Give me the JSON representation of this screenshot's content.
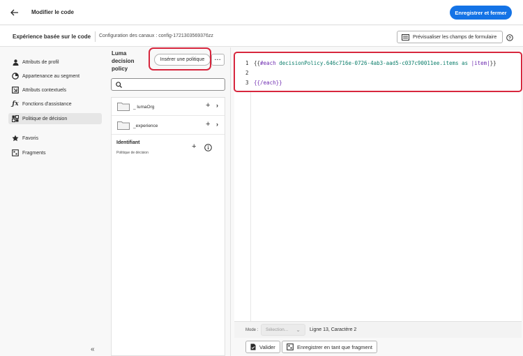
{
  "topbar": {
    "title": "Modifier le code",
    "save_close": "Enregistrer et fermer"
  },
  "subbar": {
    "title": "Expérience basée sur le code",
    "config": "Configuration des canaux : config-1721303569376zz",
    "preview_label": "Prévisualiser les champs de formulaire"
  },
  "sidebar": {
    "items": [
      {
        "label": "Attributs de profil",
        "icon": "person-icon"
      },
      {
        "label": "Appartenance au segment",
        "icon": "segment-icon"
      },
      {
        "label": "Attributs contextuels",
        "icon": "context-icon"
      },
      {
        "label": "Fonctions d'assistance",
        "icon": "function-icon"
      },
      {
        "label": "Politique de décision",
        "icon": "decision-icon",
        "active": true
      },
      {
        "label": "Favoris",
        "icon": "star-icon"
      },
      {
        "label": "Fragments",
        "icon": "fragment-icon"
      }
    ],
    "collapse_label": "«"
  },
  "midpanel": {
    "title": "Luma decision policy",
    "insert_label": "Insérer une politique",
    "more_label": "···",
    "search_placeholder": "",
    "tree": [
      {
        "label": "_ lumaOrg"
      },
      {
        "label": "_experience"
      }
    ],
    "identifier": {
      "title": "Identifiant",
      "subtitle": "Politique de décision"
    }
  },
  "editor": {
    "line_numbers": [
      "1",
      "2",
      "3"
    ],
    "line1": {
      "open": "{{",
      "kw": "#each",
      "id": "decisionPolicy.646c716e-0726-4ab3-aad5-c037c90011ee.items",
      "as": "as",
      "pipe": "|item|",
      "close": "}}"
    },
    "line3": "{{/each}}"
  },
  "statusbar": {
    "mode_label": "Mode :",
    "mode_value": "Sélection...",
    "line_info": "Ligne 13, Caractère 2"
  },
  "bottom": {
    "validate": "Valider",
    "save_fragment": "Enregistrer en tant que fragment"
  },
  "colors": {
    "primary": "#1473e6",
    "highlight": "#d7263d",
    "keyword": "#6e2bb0",
    "identifier": "#0b7d6a"
  }
}
